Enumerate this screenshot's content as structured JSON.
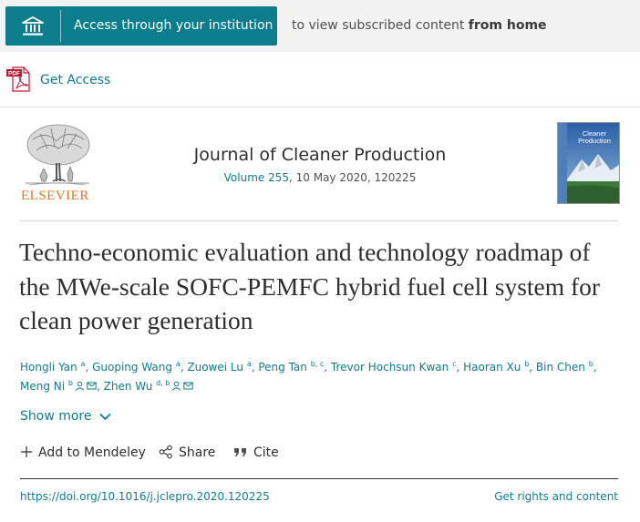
{
  "institution": {
    "button_label": "Access through your institution",
    "note_prefix": "to view subscribed content ",
    "note_bold": "from home"
  },
  "access": {
    "label": "Get Access",
    "pdf_icon_text": "PDF"
  },
  "journal": {
    "publisher": "ELSEVIER",
    "title": "Journal of Cleaner Production",
    "volume_link": "Volume 255",
    "issue_info": ", 10 May 2020, 120225",
    "cover_title_line1": "Cleaner",
    "cover_title_line2": "Production"
  },
  "article": {
    "title": "Techno-economic evaluation and technology roadmap of the MWe-scale SOFC-PEMFC hybrid fuel cell system for clean power generation"
  },
  "authors": [
    {
      "name": "Hongli Yan",
      "aff": "a"
    },
    {
      "name": "Guoping Wang",
      "aff": "a"
    },
    {
      "name": "Zuowei Lu",
      "aff": "a"
    },
    {
      "name": "Peng Tan",
      "aff": "b, c"
    },
    {
      "name": "Trevor Hochsun Kwan",
      "aff": "c"
    },
    {
      "name": "Haoran Xu",
      "aff": "b"
    },
    {
      "name": "Bin Chen",
      "aff": "b"
    },
    {
      "name": "Meng Ni",
      "aff": "b",
      "icons": [
        "person-icon",
        "mail-icon"
      ]
    },
    {
      "name": "Zhen Wu",
      "aff": "d, b",
      "icons": [
        "person-icon",
        "mail-icon"
      ]
    }
  ],
  "show_more": {
    "label": "Show more"
  },
  "actions": {
    "mendeley": "Add to Mendeley",
    "share": "Share",
    "cite": "Cite"
  },
  "footer": {
    "doi": "https://doi.org/10.1016/j.jclepro.2020.120225",
    "rights": "Get rights and content"
  },
  "colors": {
    "accent": "#0c7d8c",
    "publisher_orange": "#e9711c",
    "institution_bar": "#f2f2f2"
  }
}
